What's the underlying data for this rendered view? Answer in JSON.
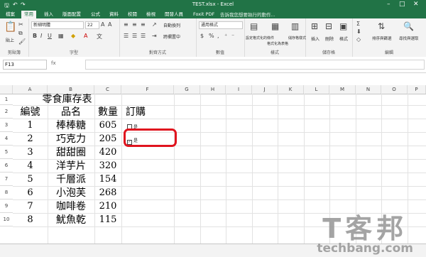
{
  "window": {
    "title": "TEST.xlsx - Excel",
    "controls": [
      "–",
      "□",
      "✕"
    ]
  },
  "tabs": [
    "檔案",
    "常用",
    "插入",
    "版面配置",
    "公式",
    "資料",
    "校閱",
    "檢視",
    "開發人員",
    "Foxit PDF"
  ],
  "active_tab": "常用",
  "tell_me": "告訴我您想要執行的動作...",
  "ribbon": {
    "clipboard_label": "剪貼簿",
    "paste_label": "貼上",
    "font_label": "字型",
    "font_name": "新細明體",
    "font_size": "22",
    "alignment_label": "對齊方式",
    "wrap_text": "自動換列",
    "merge_center": "跨欄置中",
    "number_label": "數值",
    "number_format": "通用格式",
    "styles_label": "樣式",
    "cond_format": "設定格式化的條件",
    "format_table": "格式化為表格",
    "cell_styles": "儲存格樣式",
    "cells_label": "儲存格",
    "insert": "插入",
    "delete": "刪除",
    "format": "格式",
    "editing_label": "編輯",
    "sort_filter": "排序與篩選",
    "find_select": "尋找與選取"
  },
  "name_box": "F13",
  "fx": "fx",
  "columns": [
    "A",
    "B",
    "C",
    "D",
    "E",
    "F",
    "G",
    "H",
    "I",
    "J",
    "K",
    "L",
    "M",
    "N",
    "O",
    "P"
  ],
  "rows": [
    "1",
    "2",
    "3",
    "4",
    "5",
    "6",
    "7",
    "8",
    "9",
    "10"
  ],
  "sheet": {
    "title": "零食庫存表",
    "headers": {
      "id": "編號",
      "name": "品名",
      "qty": "數量",
      "order": "訂購"
    },
    "items": [
      {
        "id": "1",
        "name": "棒棒糖",
        "qty": "605"
      },
      {
        "id": "2",
        "name": "巧克力",
        "qty": "205"
      },
      {
        "id": "3",
        "name": "甜甜圈",
        "qty": "420"
      },
      {
        "id": "4",
        "name": "洋芋片",
        "qty": "320"
      },
      {
        "id": "5",
        "name": "千層派",
        "qty": "154"
      },
      {
        "id": "6",
        "name": "小泡芙",
        "qty": "268"
      },
      {
        "id": "7",
        "name": "咖啡卷",
        "qty": "210"
      },
      {
        "id": "8",
        "name": "魷魚乾",
        "qty": "115"
      }
    ],
    "checkboxes": [
      {
        "label": "是",
        "checked": false
      },
      {
        "label": "是",
        "checked": true
      }
    ]
  },
  "watermark": {
    "big": "T客邦",
    "small": "techbang.com"
  },
  "colors": {
    "excel_green": "#217346",
    "highlight_red": "#e0141e"
  }
}
